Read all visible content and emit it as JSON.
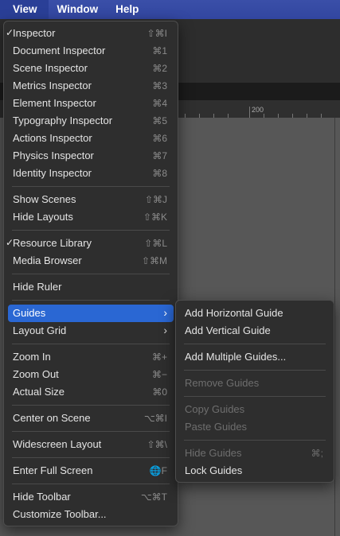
{
  "menubar": {
    "items": [
      "View",
      "Window",
      "Help"
    ]
  },
  "ruler": {
    "label": "200"
  },
  "view_menu": {
    "items": [
      {
        "label": "Inspector",
        "shortcut": "⇧⌘I",
        "checked": true
      },
      {
        "label": "Document Inspector",
        "shortcut": "⌘1"
      },
      {
        "label": "Scene Inspector",
        "shortcut": "⌘2"
      },
      {
        "label": "Metrics Inspector",
        "shortcut": "⌘3"
      },
      {
        "label": "Element Inspector",
        "shortcut": "⌘4"
      },
      {
        "label": "Typography Inspector",
        "shortcut": "⌘5"
      },
      {
        "label": "Actions Inspector",
        "shortcut": "⌘6"
      },
      {
        "label": "Physics Inspector",
        "shortcut": "⌘7"
      },
      {
        "label": "Identity Inspector",
        "shortcut": "⌘8"
      },
      {
        "label": "Show Scenes",
        "shortcut": "⇧⌘J"
      },
      {
        "label": "Hide Layouts",
        "shortcut": "⇧⌘K"
      },
      {
        "label": "Resource Library",
        "shortcut": "⇧⌘L",
        "checked": true
      },
      {
        "label": "Media Browser",
        "shortcut": "⇧⌘M"
      },
      {
        "label": "Hide Ruler",
        "shortcut": ""
      },
      {
        "label": "Guides",
        "submenu": true,
        "selected": true
      },
      {
        "label": "Layout Grid",
        "submenu": true
      },
      {
        "label": "Zoom In",
        "shortcut": "⌘+"
      },
      {
        "label": "Zoom Out",
        "shortcut": "⌘−"
      },
      {
        "label": "Actual Size",
        "shortcut": "⌘0"
      },
      {
        "label": "Center on Scene",
        "shortcut": "⌥⌘I"
      },
      {
        "label": "Widescreen Layout",
        "shortcut": "⇧⌘\\"
      },
      {
        "label": "Enter Full Screen",
        "shortcut": "🌐F"
      },
      {
        "label": "Hide Toolbar",
        "shortcut": "⌥⌘T"
      },
      {
        "label": "Customize Toolbar...",
        "shortcut": ""
      }
    ]
  },
  "guides_menu": {
    "items": [
      {
        "label": "Add Horizontal Guide"
      },
      {
        "label": "Add Vertical Guide"
      },
      {
        "label": "Add Multiple Guides..."
      },
      {
        "label": "Remove Guides",
        "disabled": true
      },
      {
        "label": "Copy Guides",
        "disabled": true
      },
      {
        "label": "Paste Guides",
        "disabled": true
      },
      {
        "label": "Hide Guides",
        "shortcut": "⌘;",
        "disabled": true
      },
      {
        "label": "Lock Guides"
      }
    ]
  },
  "colors": {
    "highlight": "#2a67d3",
    "menubar": "#3a4fa8",
    "menu_bg": "#2e2e2e"
  }
}
